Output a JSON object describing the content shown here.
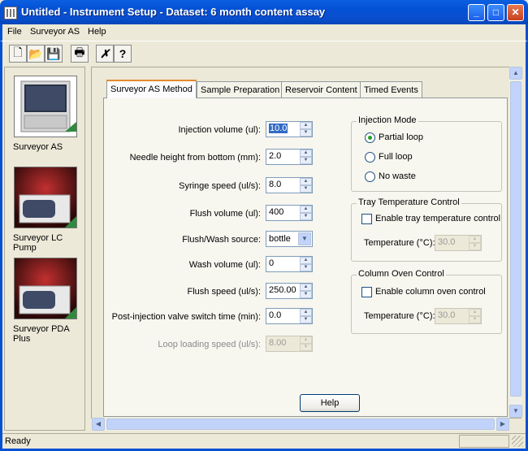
{
  "window": {
    "title": "Untitled - Instrument Setup - Dataset: 6 month content assay",
    "minimize_glyph": "_",
    "maximize_glyph": "□",
    "close_glyph": "✕"
  },
  "menu": {
    "file": "File",
    "surveyor": "Surveyor AS",
    "help": "Help"
  },
  "toolbar": {
    "new_icon": "🗋",
    "open_icon": "📂",
    "save_icon": "💾",
    "print_icon": "🖶",
    "cut_icon": "✗",
    "help_icon": "?"
  },
  "instruments": [
    {
      "label": "Surveyor AS"
    },
    {
      "label": "Surveyor LC Pump"
    },
    {
      "label": "Surveyor PDA Plus"
    }
  ],
  "tabs": [
    {
      "label": "Surveyor AS Method"
    },
    {
      "label": "Sample Preparation"
    },
    {
      "label": "Reservoir Content"
    },
    {
      "label": "Timed Events"
    }
  ],
  "fields": {
    "injection_volume": {
      "label": "Injection volume (ul):",
      "value": "10.0"
    },
    "needle_height": {
      "label": "Needle height from bottom (mm):",
      "value": "2.0"
    },
    "syringe_speed": {
      "label": "Syringe speed (ul/s):",
      "value": "8.0"
    },
    "flush_volume": {
      "label": "Flush volume (ul):",
      "value": "400"
    },
    "flush_source": {
      "label": "Flush/Wash source:",
      "value": "bottle"
    },
    "wash_volume": {
      "label": "Wash volume (ul):",
      "value": "0"
    },
    "flush_speed": {
      "label": "Flush speed (ul/s):",
      "value": "250.00"
    },
    "post_injection": {
      "label": "Post-injection valve switch time (min):",
      "value": "0.0"
    },
    "loop_loading": {
      "label": "Loop loading speed (ul/s):",
      "value": "8.00"
    }
  },
  "injection_mode": {
    "title": "Injection Mode",
    "options": [
      {
        "label": "Partial loop",
        "selected": true
      },
      {
        "label": "Full loop",
        "selected": false
      },
      {
        "label": "No waste",
        "selected": false
      }
    ]
  },
  "tray_temp": {
    "title": "Tray Temperature Control",
    "enable_label": "Enable tray temperature control",
    "temp_label": "Temperature (°C):",
    "temp_value": "30.0"
  },
  "column_oven": {
    "title": "Column Oven Control",
    "enable_label": "Enable column oven control",
    "temp_label": "Temperature (°C):",
    "temp_value": "30.0"
  },
  "help_button": "Help",
  "status": {
    "text": "Ready"
  },
  "colors": {
    "accent": "#0450d4",
    "selection": "#316ac5",
    "tab_highlight": "#e68b2c"
  }
}
